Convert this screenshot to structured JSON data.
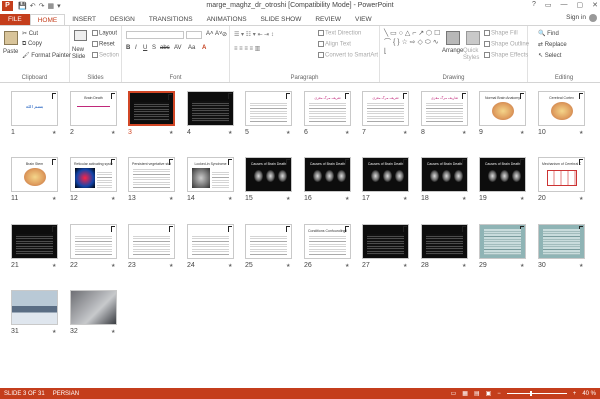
{
  "window_title": "marge_maghz_dr_otroshi [Compatibility Mode] - PowerPoint",
  "qat": [
    "💾",
    "↶",
    "↷",
    "▦",
    "▾"
  ],
  "window_controls": [
    "?",
    "▭",
    "—",
    "▢",
    "✕"
  ],
  "tabs": [
    "FILE",
    "HOME",
    "INSERT",
    "DESIGN",
    "TRANSITIONS",
    "ANIMATIONS",
    "SLIDE SHOW",
    "REVIEW",
    "VIEW"
  ],
  "active_tab": "HOME",
  "sign_in": "Sign in",
  "ribbon": {
    "clipboard": {
      "label": "Clipboard",
      "paste": "Paste",
      "cut": "Cut",
      "copy": "Copy",
      "format_painter": "Format Painter"
    },
    "slides": {
      "label": "Slides",
      "new_slide": "New Slide",
      "layout": "Layout",
      "reset": "Reset",
      "section": "Section"
    },
    "font": {
      "label": "Font",
      "bold": "B",
      "italic": "I",
      "underline": "U",
      "shadow": "S",
      "strike": "abc",
      "spacing": "AV",
      "case": "Aa",
      "color": "A",
      "grow": "A˄",
      "shrink": "A˅",
      "clear": "⊘"
    },
    "paragraph": {
      "label": "Paragraph",
      "text_direction": "Text Direction",
      "align_text": "Align Text",
      "smartart": "Convert to SmartArt"
    },
    "drawing": {
      "label": "Drawing",
      "arrange": "Arrange",
      "quick_styles": "Quick Styles",
      "shape_fill": "Shape Fill",
      "shape_outline": "Shape Outline",
      "shape_effects": "Shape Effects"
    },
    "editing": {
      "label": "Editing",
      "find": "Find",
      "replace": "Replace",
      "select": "Select"
    }
  },
  "slides": [
    {
      "num": "1",
      "title": "بسم الله",
      "kind": "title"
    },
    {
      "num": "2",
      "title": "Brain Death",
      "kind": "brain"
    },
    {
      "num": "3",
      "title": "",
      "kind": "dark-selected"
    },
    {
      "num": "4",
      "title": "",
      "kind": "dark"
    },
    {
      "num": "5",
      "title": "",
      "kind": "text"
    },
    {
      "num": "6",
      "title": "تعريف مرگ مغزی",
      "kind": "text-pink"
    },
    {
      "num": "7",
      "title": "تعريف مرگ مغزی",
      "kind": "text-pink"
    },
    {
      "num": "8",
      "title": "تعاريف مرگ مغزی",
      "kind": "text-pink"
    },
    {
      "num": "9",
      "title": "Normal Brain Anatomy",
      "kind": "anatomy"
    },
    {
      "num": "10",
      "title": "Cerebral Cortex",
      "kind": "cortex"
    },
    {
      "num": "11",
      "title": "Brain Stem",
      "kind": "stem"
    },
    {
      "num": "12",
      "title": "Reticular activating system",
      "kind": "ras"
    },
    {
      "num": "13",
      "title": "Persistent vegetative state",
      "kind": "text"
    },
    {
      "num": "14",
      "title": "Locked-in Syndrome",
      "kind": "locked"
    },
    {
      "num": "15",
      "title": "Causes of Brain Death",
      "kind": "ct"
    },
    {
      "num": "16",
      "title": "Causes of Brain Death",
      "kind": "ct"
    },
    {
      "num": "17",
      "title": "Causes of Brain Death",
      "kind": "ct"
    },
    {
      "num": "18",
      "title": "Causes of Brain Death",
      "kind": "ct"
    },
    {
      "num": "19",
      "title": "Causes of Brain Death",
      "kind": "ct"
    },
    {
      "num": "20",
      "title": "Mechanism of Cerebral Death",
      "kind": "mech"
    },
    {
      "num": "21",
      "title": "",
      "kind": "dark-red"
    },
    {
      "num": "22",
      "title": "",
      "kind": "text"
    },
    {
      "num": "23",
      "title": "",
      "kind": "text"
    },
    {
      "num": "24",
      "title": "",
      "kind": "text"
    },
    {
      "num": "25",
      "title": "",
      "kind": "text"
    },
    {
      "num": "26",
      "title": "Conditions Confounding Brain Death",
      "kind": "text"
    },
    {
      "num": "27",
      "title": "",
      "kind": "dark"
    },
    {
      "num": "28",
      "title": "",
      "kind": "dark"
    },
    {
      "num": "29",
      "title": "",
      "kind": "doc"
    },
    {
      "num": "30",
      "title": "",
      "kind": "doc"
    },
    {
      "num": "31",
      "title": "",
      "kind": "photo-sky"
    },
    {
      "num": "32",
      "title": "",
      "kind": "photo-laptop"
    }
  ],
  "status": {
    "slide_info": "SLIDE 3 OF 31",
    "language": "PERSIAN",
    "zoom": "40 %",
    "zoom_fraction": 0.4
  },
  "colors": {
    "accent": "#c43e1c",
    "selected_border": "#d24726"
  }
}
